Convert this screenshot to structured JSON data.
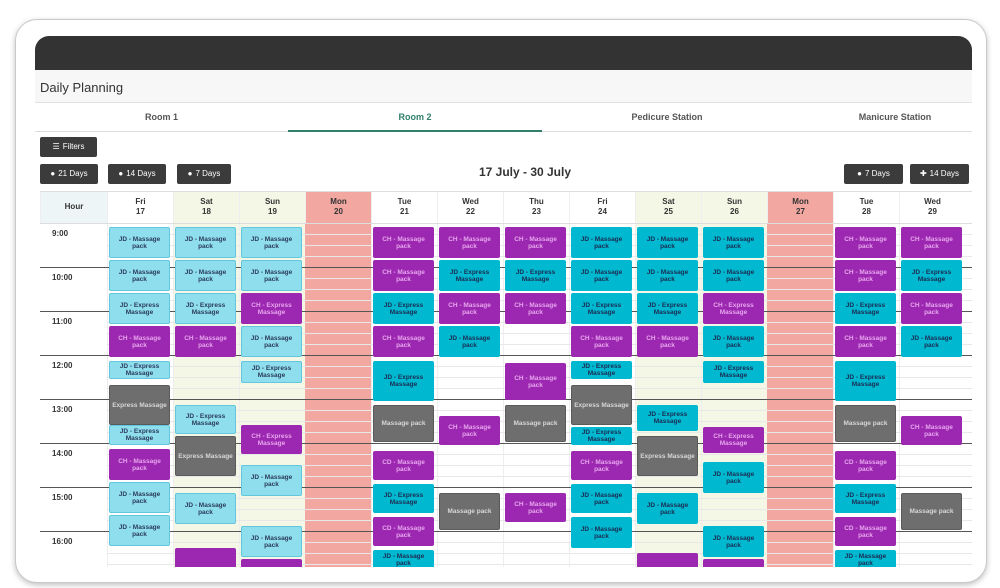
{
  "app": {
    "title": "Daily Planning"
  },
  "tabs": [
    {
      "label": "Room 1",
      "active": false
    },
    {
      "label": "Room 2",
      "active": true
    },
    {
      "label": "Pedicure Station",
      "active": false
    },
    {
      "label": "Manicure Station",
      "active": false
    }
  ],
  "toolbar": {
    "filters_label": "Filters",
    "back_21": "21 Days",
    "back_14": "14 Days",
    "back_7": "7 Days",
    "fwd_7": "7 Days",
    "fwd_14": "14 Days"
  },
  "date_range": "17 July - 30 July",
  "hour_header": "Hour",
  "hours": [
    "9:00",
    "10:00",
    "11:00",
    "12:00",
    "13:00",
    "14:00",
    "15:00",
    "16:00"
  ],
  "days": [
    {
      "name": "Fri",
      "num": "17",
      "type": "normal"
    },
    {
      "name": "Sat",
      "num": "18",
      "type": "weekend"
    },
    {
      "name": "Sun",
      "num": "19",
      "type": "weekend"
    },
    {
      "name": "Mon",
      "num": "20",
      "type": "closed"
    },
    {
      "name": "Tue",
      "num": "21",
      "type": "normal"
    },
    {
      "name": "Wed",
      "num": "22",
      "type": "normal"
    },
    {
      "name": "Thu",
      "num": "23",
      "type": "normal"
    },
    {
      "name": "Fri",
      "num": "24",
      "type": "normal"
    },
    {
      "name": "Sat",
      "num": "25",
      "type": "weekend"
    },
    {
      "name": "Sun",
      "num": "26",
      "type": "weekend"
    },
    {
      "name": "Mon",
      "num": "27",
      "type": "closed"
    },
    {
      "name": "Tue",
      "num": "28",
      "type": "normal"
    },
    {
      "name": "Wed",
      "num": "29",
      "type": "normal"
    }
  ],
  "colors": {
    "weekend": "#f4f6e6",
    "closed": "#f2a7a1",
    "normal": "#ffffff",
    "accent": "#2f7f6a"
  },
  "appointments": [
    {
      "day": 0,
      "start": 9.0,
      "end": 9.7,
      "label": "JD - Massage pack",
      "style": "light"
    },
    {
      "day": 0,
      "start": 9.75,
      "end": 10.45,
      "label": "JD - Massage pack",
      "style": "light"
    },
    {
      "day": 0,
      "start": 10.5,
      "end": 11.2,
      "label": "JD - Express Massage",
      "style": "light"
    },
    {
      "day": 0,
      "start": 11.25,
      "end": 11.95,
      "label": "CH - Massage pack",
      "style": "purple"
    },
    {
      "day": 0,
      "start": 12.05,
      "end": 12.45,
      "label": "JD - Express Massage",
      "style": "light"
    },
    {
      "day": 0,
      "start": 12.6,
      "end": 13.5,
      "label": "Express Massage",
      "style": "gray"
    },
    {
      "day": 0,
      "start": 13.5,
      "end": 13.95,
      "label": "JD - Express Massage",
      "style": "light"
    },
    {
      "day": 0,
      "start": 14.05,
      "end": 14.75,
      "label": "CH - Massage pack",
      "style": "purple"
    },
    {
      "day": 0,
      "start": 14.8,
      "end": 15.5,
      "label": "JD - Massage pack",
      "style": "light"
    },
    {
      "day": 0,
      "start": 15.55,
      "end": 16.25,
      "label": "JD - Massage pack",
      "style": "light"
    },
    {
      "day": 1,
      "start": 9.0,
      "end": 9.7,
      "label": "JD - Massage pack",
      "style": "light"
    },
    {
      "day": 1,
      "start": 9.75,
      "end": 10.45,
      "label": "JD - Massage pack",
      "style": "light"
    },
    {
      "day": 1,
      "start": 10.5,
      "end": 11.2,
      "label": "JD - Express Massage",
      "style": "light"
    },
    {
      "day": 1,
      "start": 11.25,
      "end": 11.95,
      "label": "CH - Massage pack",
      "style": "purple"
    },
    {
      "day": 1,
      "start": 13.05,
      "end": 13.7,
      "label": "JD - Express Massage",
      "style": "light"
    },
    {
      "day": 1,
      "start": 13.75,
      "end": 14.65,
      "label": "Express Massage",
      "style": "gray"
    },
    {
      "day": 1,
      "start": 15.05,
      "end": 15.75,
      "label": "JD - Massage pack",
      "style": "light"
    },
    {
      "day": 1,
      "start": 16.3,
      "end": 16.8,
      "label": "",
      "style": "purple"
    },
    {
      "day": 2,
      "start": 9.0,
      "end": 9.7,
      "label": "JD - Massage pack",
      "style": "light"
    },
    {
      "day": 2,
      "start": 9.75,
      "end": 10.45,
      "label": "JD - Massage pack",
      "style": "light"
    },
    {
      "day": 2,
      "start": 10.5,
      "end": 11.2,
      "label": "CH - Express Massage",
      "style": "purple"
    },
    {
      "day": 2,
      "start": 11.25,
      "end": 11.95,
      "label": "JD - Massage pack",
      "style": "light"
    },
    {
      "day": 2,
      "start": 12.05,
      "end": 12.55,
      "label": "JD - Express Massage",
      "style": "light"
    },
    {
      "day": 2,
      "start": 13.5,
      "end": 14.15,
      "label": "CH - Express Massage",
      "style": "purple"
    },
    {
      "day": 2,
      "start": 14.4,
      "end": 15.1,
      "label": "JD - Massage pack",
      "style": "light"
    },
    {
      "day": 2,
      "start": 15.8,
      "end": 16.5,
      "label": "JD - Massage pack",
      "style": "light"
    },
    {
      "day": 2,
      "start": 16.55,
      "end": 16.8,
      "label": "",
      "style": "purple"
    },
    {
      "day": 4,
      "start": 9.0,
      "end": 9.7,
      "label": "CH - Massage pack",
      "style": "purple"
    },
    {
      "day": 4,
      "start": 9.75,
      "end": 10.45,
      "label": "CH - Massage pack",
      "style": "purple"
    },
    {
      "day": 4,
      "start": 10.5,
      "end": 11.2,
      "label": "JD - Express Massage",
      "style": "teal"
    },
    {
      "day": 4,
      "start": 11.25,
      "end": 11.95,
      "label": "CH - Massage pack",
      "style": "purple"
    },
    {
      "day": 4,
      "start": 12.05,
      "end": 12.95,
      "label": "JD - Express Massage",
      "style": "teal"
    },
    {
      "day": 4,
      "start": 13.05,
      "end": 13.9,
      "label": "Massage pack",
      "style": "gray"
    },
    {
      "day": 4,
      "start": 14.1,
      "end": 14.75,
      "label": "CD - Massage pack",
      "style": "purple"
    },
    {
      "day": 4,
      "start": 14.85,
      "end": 15.5,
      "label": "JD - Express Massage",
      "style": "teal"
    },
    {
      "day": 4,
      "start": 15.6,
      "end": 16.25,
      "label": "CD - Massage pack",
      "style": "purple"
    },
    {
      "day": 4,
      "start": 16.35,
      "end": 16.8,
      "label": "JD - Massage pack",
      "style": "teal"
    },
    {
      "day": 5,
      "start": 9.0,
      "end": 9.7,
      "label": "CH - Massage pack",
      "style": "purple"
    },
    {
      "day": 5,
      "start": 9.75,
      "end": 10.45,
      "label": "JD - Express Massage",
      "style": "teal"
    },
    {
      "day": 5,
      "start": 10.5,
      "end": 11.2,
      "label": "CH - Massage pack",
      "style": "purple"
    },
    {
      "day": 5,
      "start": 11.25,
      "end": 11.95,
      "label": "JD - Massage pack",
      "style": "teal"
    },
    {
      "day": 5,
      "start": 13.3,
      "end": 13.95,
      "label": "CH - Massage pack",
      "style": "purple"
    },
    {
      "day": 5,
      "start": 15.05,
      "end": 15.9,
      "label": "Massage pack",
      "style": "gray"
    },
    {
      "day": 6,
      "start": 9.0,
      "end": 9.7,
      "label": "CH - Massage pack",
      "style": "purple"
    },
    {
      "day": 6,
      "start": 9.75,
      "end": 10.45,
      "label": "JD - Express Massage",
      "style": "teal"
    },
    {
      "day": 6,
      "start": 10.5,
      "end": 11.2,
      "label": "CH - Massage pack",
      "style": "purple"
    },
    {
      "day": 6,
      "start": 12.1,
      "end": 12.95,
      "label": "CH - Massage pack",
      "style": "purple"
    },
    {
      "day": 6,
      "start": 13.05,
      "end": 13.9,
      "label": "Massage pack",
      "style": "gray"
    },
    {
      "day": 6,
      "start": 15.05,
      "end": 15.7,
      "label": "CH - Massage pack",
      "style": "purple"
    },
    {
      "day": 7,
      "start": 9.0,
      "end": 9.7,
      "label": "JD - Massage pack",
      "style": "teal"
    },
    {
      "day": 7,
      "start": 9.75,
      "end": 10.45,
      "label": "JD - Massage pack",
      "style": "teal"
    },
    {
      "day": 7,
      "start": 10.5,
      "end": 11.2,
      "label": "JD - Express Massage",
      "style": "teal"
    },
    {
      "day": 7,
      "start": 11.25,
      "end": 11.95,
      "label": "CH - Massage pack",
      "style": "purple"
    },
    {
      "day": 7,
      "start": 12.05,
      "end": 12.45,
      "label": "JD - Express Massage",
      "style": "teal"
    },
    {
      "day": 7,
      "start": 12.6,
      "end": 13.5,
      "label": "Express Massage",
      "style": "gray"
    },
    {
      "day": 7,
      "start": 13.55,
      "end": 13.95,
      "label": "JD - Express Massage",
      "style": "teal"
    },
    {
      "day": 7,
      "start": 14.1,
      "end": 14.75,
      "label": "CH - Massage pack",
      "style": "purple"
    },
    {
      "day": 7,
      "start": 14.85,
      "end": 15.5,
      "label": "JD - Massage pack",
      "style": "teal"
    },
    {
      "day": 7,
      "start": 15.6,
      "end": 16.3,
      "label": "JD - Massage pack",
      "style": "teal"
    },
    {
      "day": 8,
      "start": 9.0,
      "end": 9.7,
      "label": "JD - Massage pack",
      "style": "teal"
    },
    {
      "day": 8,
      "start": 9.75,
      "end": 10.45,
      "label": "JD - Massage pack",
      "style": "teal"
    },
    {
      "day": 8,
      "start": 10.5,
      "end": 11.2,
      "label": "JD - Express Massage",
      "style": "teal"
    },
    {
      "day": 8,
      "start": 11.25,
      "end": 11.95,
      "label": "CH - Massage pack",
      "style": "purple"
    },
    {
      "day": 8,
      "start": 13.05,
      "end": 13.65,
      "label": "JD - Express Massage",
      "style": "teal"
    },
    {
      "day": 8,
      "start": 13.75,
      "end": 14.65,
      "label": "Express Massage",
      "style": "gray"
    },
    {
      "day": 8,
      "start": 15.05,
      "end": 15.75,
      "label": "JD - Massage pack",
      "style": "teal"
    },
    {
      "day": 8,
      "start": 16.4,
      "end": 16.8,
      "label": "",
      "style": "purple"
    },
    {
      "day": 9,
      "start": 9.0,
      "end": 9.7,
      "label": "JD - Massage pack",
      "style": "teal"
    },
    {
      "day": 9,
      "start": 9.75,
      "end": 10.45,
      "label": "JD - Massage pack",
      "style": "teal"
    },
    {
      "day": 9,
      "start": 10.5,
      "end": 11.2,
      "label": "CH - Express Massage",
      "style": "purple"
    },
    {
      "day": 9,
      "start": 11.25,
      "end": 11.95,
      "label": "JD - Massage pack",
      "style": "teal"
    },
    {
      "day": 9,
      "start": 12.05,
      "end": 12.55,
      "label": "JD - Express Massage",
      "style": "teal"
    },
    {
      "day": 9,
      "start": 13.55,
      "end": 14.15,
      "label": "CH - Express Massage",
      "style": "purple"
    },
    {
      "day": 9,
      "start": 14.35,
      "end": 15.05,
      "label": "JD - Massage pack",
      "style": "teal"
    },
    {
      "day": 9,
      "start": 15.8,
      "end": 16.5,
      "label": "JD - Massage pack",
      "style": "teal"
    },
    {
      "day": 9,
      "start": 16.55,
      "end": 16.8,
      "label": "",
      "style": "purple"
    },
    {
      "day": 11,
      "start": 9.0,
      "end": 9.7,
      "label": "CH - Massage pack",
      "style": "purple"
    },
    {
      "day": 11,
      "start": 9.75,
      "end": 10.45,
      "label": "CH - Massage pack",
      "style": "purple"
    },
    {
      "day": 11,
      "start": 10.5,
      "end": 11.2,
      "label": "JD - Express Massage",
      "style": "teal"
    },
    {
      "day": 11,
      "start": 11.25,
      "end": 11.95,
      "label": "CH - Massage pack",
      "style": "purple"
    },
    {
      "day": 11,
      "start": 12.05,
      "end": 12.95,
      "label": "JD - Express Massage",
      "style": "teal"
    },
    {
      "day": 11,
      "start": 13.05,
      "end": 13.9,
      "label": "Massage pack",
      "style": "gray"
    },
    {
      "day": 11,
      "start": 14.1,
      "end": 14.75,
      "label": "CD - Massage pack",
      "style": "purple"
    },
    {
      "day": 11,
      "start": 14.85,
      "end": 15.5,
      "label": "JD - Express Massage",
      "style": "teal"
    },
    {
      "day": 11,
      "start": 15.6,
      "end": 16.25,
      "label": "CD - Massage pack",
      "style": "purple"
    },
    {
      "day": 11,
      "start": 16.35,
      "end": 16.8,
      "label": "JD - Massage pack",
      "style": "teal"
    },
    {
      "day": 12,
      "start": 9.0,
      "end": 9.7,
      "label": "CH - Massage pack",
      "style": "purple"
    },
    {
      "day": 12,
      "start": 9.75,
      "end": 10.45,
      "label": "JD - Express Massage",
      "style": "teal"
    },
    {
      "day": 12,
      "start": 10.5,
      "end": 11.2,
      "label": "CH - Massage pack",
      "style": "purple"
    },
    {
      "day": 12,
      "start": 11.25,
      "end": 11.95,
      "label": "JD - Massage pack",
      "style": "teal"
    },
    {
      "day": 12,
      "start": 13.3,
      "end": 13.95,
      "label": "CH - Massage pack",
      "style": "purple"
    },
    {
      "day": 12,
      "start": 15.05,
      "end": 15.9,
      "label": "Massage pack",
      "style": "gray"
    }
  ]
}
